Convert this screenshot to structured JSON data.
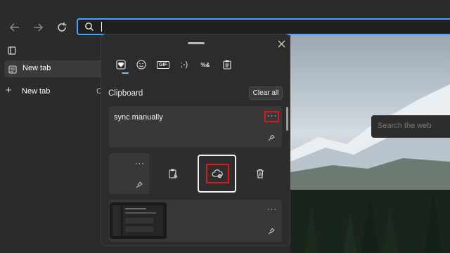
{
  "browser": {
    "nav": {
      "back_icon": "back-arrow-icon",
      "forward_icon": "forward-arrow-icon",
      "refresh_icon": "refresh-icon"
    },
    "address": {
      "value": ""
    },
    "sidebar": {
      "tabs": [
        {
          "label": "New tab",
          "active": true
        },
        {
          "label": "New tab",
          "active": false,
          "prefix": "+"
        }
      ],
      "truncated_char": "C"
    },
    "content": {
      "search_placeholder": "Search the web"
    }
  },
  "clipboard_panel": {
    "tabs": [
      {
        "icon": "heart-sticker-icon"
      },
      {
        "icon": "emoji-icon"
      },
      {
        "icon": "gif-icon",
        "text": "GIF"
      },
      {
        "icon": "kaomoji-icon",
        "text": ";-)"
      },
      {
        "icon": "symbols-icon",
        "text": "%&"
      },
      {
        "icon": "clipboard-icon",
        "selected": true
      }
    ],
    "title": "Clipboard",
    "clear_all": "Clear all",
    "items": [
      {
        "text": "sync manually",
        "more": "···"
      },
      {
        "more": "···"
      }
    ],
    "accent": "#8ab4f8",
    "highlight": "#e0161e"
  }
}
